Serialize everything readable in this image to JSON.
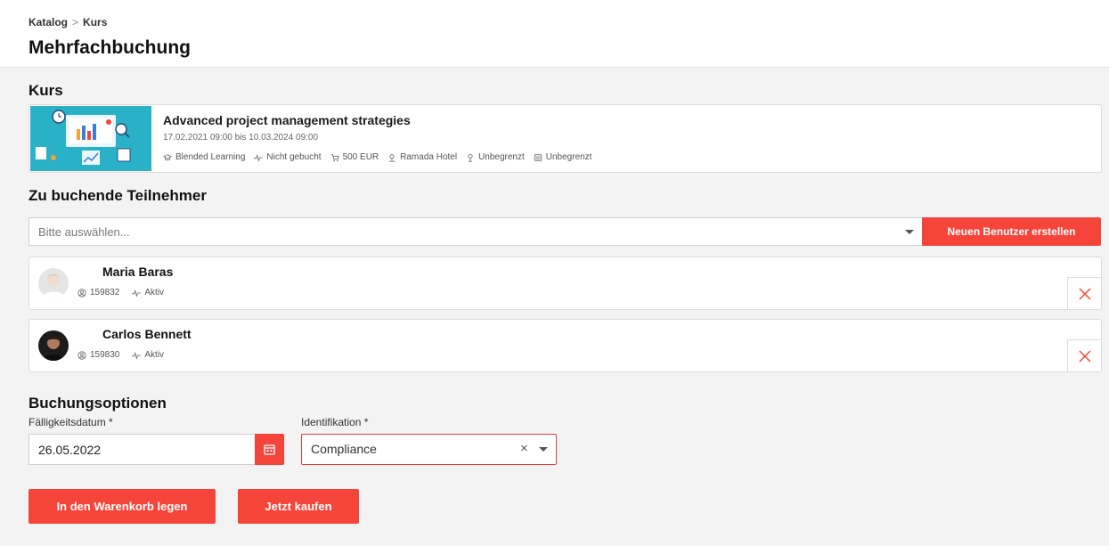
{
  "breadcrumb": {
    "items": [
      "Katalog",
      "Kurs"
    ],
    "separator": ">"
  },
  "page": {
    "title": "Mehrfachbuchung"
  },
  "course_section": {
    "heading": "Kurs",
    "course": {
      "title": "Advanced project management strategies",
      "dates": "17.02.2021 09:00 bis 10.03.2024 09:00",
      "meta": {
        "type": "Blended Learning",
        "status": "Nicht gebucht",
        "price": "500 EUR",
        "location": "Ramada Hotel",
        "seats": "Unbegrenzt",
        "capacity": "Unbegrenzt"
      }
    }
  },
  "participants_section": {
    "heading": "Zu buchende Teilnehmer",
    "select_placeholder": "Bitte auswählen...",
    "new_user_button": "Neuen Benutzer erstellen",
    "participants": [
      {
        "name": "Maria Baras",
        "id": "159832",
        "status": "Aktiv"
      },
      {
        "name": "Carlos Bennett",
        "id": "159830",
        "status": "Aktiv"
      }
    ]
  },
  "booking_options": {
    "heading": "Buchungsoptionen",
    "due_date_label": "Fälligkeitsdatum *",
    "due_date_value": "26.05.2022",
    "identification_label": "Identifikation *",
    "identification_value": "Compliance",
    "clear_symbol": "×"
  },
  "actions": {
    "add_to_cart": "In den Warenkorb legen",
    "buy_now": "Jetzt kaufen"
  },
  "colors": {
    "accent": "#f5453a",
    "thumbnail": "#29b1c8"
  }
}
